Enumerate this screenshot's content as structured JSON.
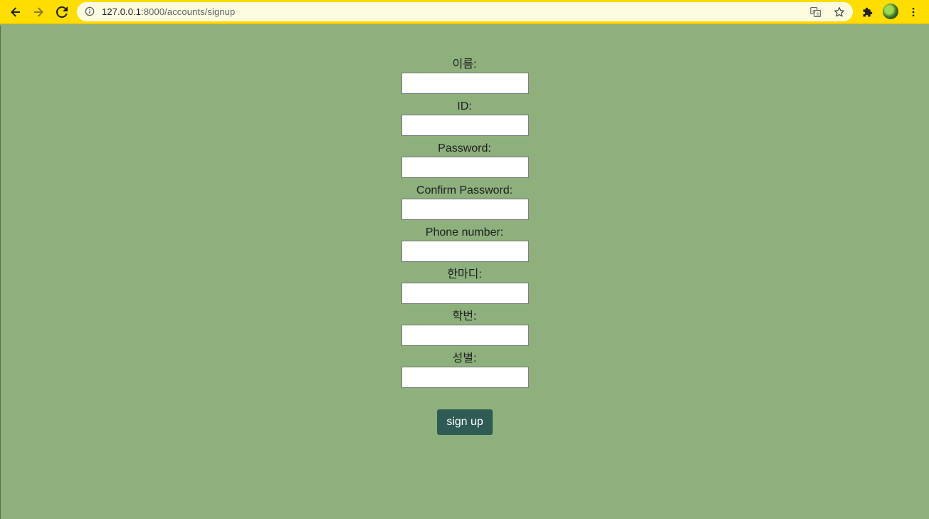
{
  "browser": {
    "url_host": "127.0.0.1",
    "url_rest": ":8000/accounts/signup"
  },
  "form": {
    "fields": [
      {
        "label": "이름:",
        "value": ""
      },
      {
        "label": "ID:",
        "value": ""
      },
      {
        "label": "Password:",
        "value": ""
      },
      {
        "label": "Confirm Password:",
        "value": ""
      },
      {
        "label": "Phone number:",
        "value": ""
      },
      {
        "label": "한마디:",
        "value": ""
      },
      {
        "label": "학번:",
        "value": ""
      },
      {
        "label": "성별:",
        "value": ""
      }
    ],
    "submit_label": "sign up"
  },
  "colors": {
    "page_bg": "#8db07d",
    "toolbar_bg": "#ffdd00",
    "button_bg": "#2f5b54"
  },
  "icons": [
    "back-arrow-icon",
    "forward-arrow-icon",
    "reload-icon",
    "info-icon",
    "translate-icon",
    "star-icon",
    "extensions-icon",
    "menu-icon"
  ]
}
